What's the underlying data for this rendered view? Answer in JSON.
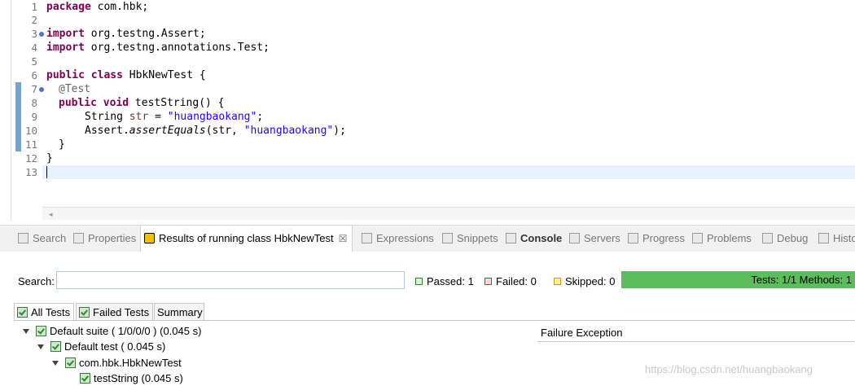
{
  "editor": {
    "line_numbers": [
      "1",
      "2",
      "3",
      "4",
      "5",
      "6",
      "7",
      "8",
      "9",
      "10",
      "11",
      "12",
      "13"
    ],
    "code": {
      "l1_kw": "package",
      "l1_rest": " com.hbk;",
      "l3_kw": "import",
      "l3_rest": " org.testng.Assert;",
      "l4_kw": "import",
      "l4_rest": " org.testng.annotations.Test;",
      "l6_kw1": "public",
      "l6_kw2": "class",
      "l6_rest": " HbkNewTest {",
      "l7_ann": "@Test",
      "l8_kw1": "public",
      "l8_kw2": "void",
      "l8_rest": " testString() {",
      "l9_type": "String ",
      "l9_var": "str",
      "l9_eq": " = ",
      "l9_str": "\"huangbaokang\"",
      "l9_end": ";",
      "l10_obj": "Assert.",
      "l10_method": "assertEquals",
      "l10_open": "(str, ",
      "l10_str": "\"huangbaokang\"",
      "l10_end": ");",
      "l11": "}",
      "l12": "}"
    }
  },
  "tabs": [
    {
      "label": "Search",
      "icon": "search-icon"
    },
    {
      "label": "Properties",
      "icon": "properties-icon"
    },
    {
      "label": "Results of running class HbkNewTest",
      "icon": "testng-icon",
      "close": "☒"
    },
    {
      "label": "Expressions",
      "icon": "expressions-icon"
    },
    {
      "label": "Snippets",
      "icon": "snippets-icon"
    },
    {
      "label": "Console",
      "icon": "console-icon"
    },
    {
      "label": "Servers",
      "icon": "servers-icon"
    },
    {
      "label": "Progress",
      "icon": "progress-icon"
    },
    {
      "label": "Problems",
      "icon": "problems-icon"
    },
    {
      "label": "Debug",
      "icon": "debug-icon"
    },
    {
      "label": "Histo",
      "icon": "history-icon"
    }
  ],
  "results": {
    "search_label": "Search:",
    "search_value": "",
    "passed": "Passed: 1",
    "failed": "Failed: 0",
    "skipped": "Skipped: 0",
    "progress_text": "Tests: 1/1  Methods: 1",
    "progress_fraction": 1.0,
    "colors": {
      "passed": "#2d8a2d",
      "failed": "#c83232",
      "skipped": "#c8a000",
      "progress": "#5bbd5b"
    }
  },
  "inner_tabs": [
    "All Tests",
    "Failed Tests",
    "Summary"
  ],
  "tree": [
    "Default suite ( 1/0/0/0 ) (0.045 s)",
    "Default test ( 0.045 s)",
    "com.hbk.HbkNewTest",
    "testString  (0.045 s)"
  ],
  "failure_label": "Failure Exception",
  "watermark": "https://blog.csdn.net/huangbaokang"
}
